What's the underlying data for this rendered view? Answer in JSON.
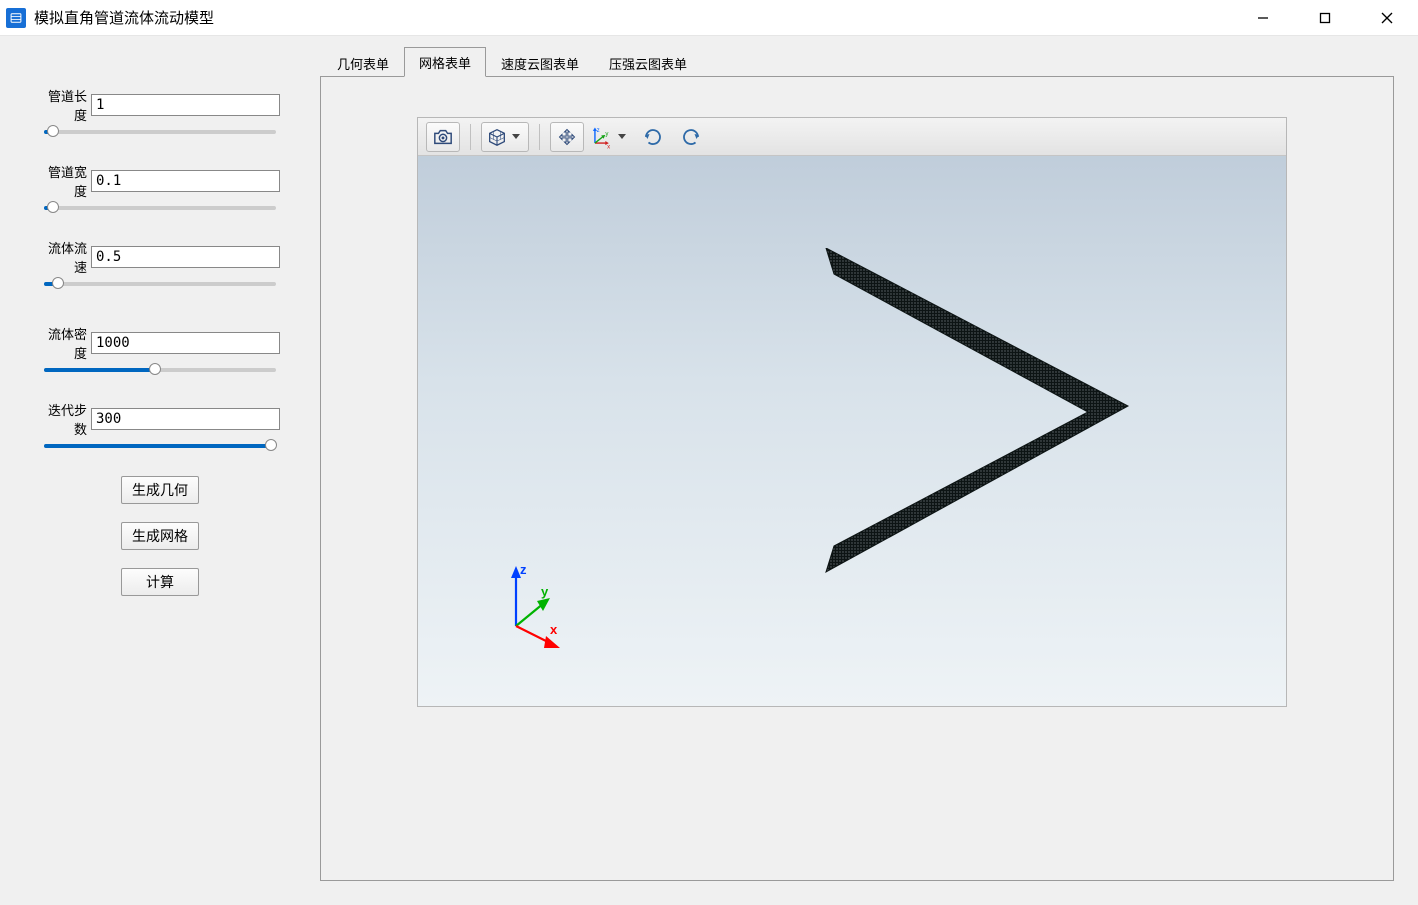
{
  "window": {
    "title": "模拟直角管道流体流动模型"
  },
  "params": [
    {
      "label": "管道长度",
      "value": "1",
      "slider_pct": 4
    },
    {
      "label": "管道宽度",
      "value": "0.1",
      "slider_pct": 4
    },
    {
      "label": "流体流速",
      "value": "0.5",
      "slider_pct": 6
    },
    {
      "label": "流体密度",
      "value": "1000",
      "slider_pct": 48
    },
    {
      "label": "迭代步数",
      "value": "300",
      "slider_pct": 98
    }
  ],
  "buttons": {
    "gen_geometry": "生成几何",
    "gen_mesh": "生成网格",
    "compute": "计算"
  },
  "tabs": [
    {
      "id": "geometry",
      "label": "几何表单",
      "active": false
    },
    {
      "id": "mesh",
      "label": "网格表单",
      "active": true
    },
    {
      "id": "velocity",
      "label": "速度云图表单",
      "active": false
    },
    {
      "id": "pressure",
      "label": "压强云图表单",
      "active": false
    }
  ],
  "viewport_toolbar": [
    {
      "name": "screenshot",
      "icon": "camera"
    },
    {
      "name": "view-cube",
      "icon": "cube",
      "dropdown": true
    },
    {
      "name": "sep"
    },
    {
      "name": "pan",
      "icon": "move"
    },
    {
      "name": "axis-menu",
      "icon": "axis",
      "dropdown": true
    },
    {
      "name": "rotate-cw",
      "icon": "rot-cw"
    },
    {
      "name": "rotate-ccw",
      "icon": "rot-ccw"
    }
  ],
  "axis_labels": {
    "x": "x",
    "y": "y",
    "z": "z"
  }
}
